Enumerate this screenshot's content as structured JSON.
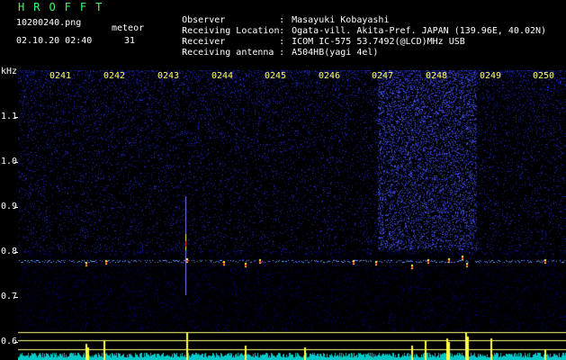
{
  "header": {
    "logo": "HROFFT",
    "logo_color": "#33ff66",
    "filename": "10200240.png",
    "datetime": "02.10.20 02:40",
    "meteor_label": "meteor",
    "meteor_count": "31"
  },
  "meta": [
    {
      "key": "Observer",
      "value": "Masayuki Kobayashi"
    },
    {
      "key": "Receiving Location",
      "value": "Ogata-vill. Akita-Pref. JAPAN (139.96E, 40.02N)"
    },
    {
      "key": "Receiver",
      "value": "ICOM IC-575 53.7492(@LCD)MHz USB"
    },
    {
      "key": "Receiving antenna",
      "value": "A504HB(yagi 4el)"
    }
  ],
  "axis": {
    "unit": "kHz",
    "freq_labels": [
      "1.1",
      "1.0",
      "0.9",
      "0.8",
      "0.7",
      "0.6"
    ],
    "time_labels": [
      "0241",
      "0242",
      "0243",
      "0244",
      "0245",
      "0246",
      "0247",
      "0248",
      "0249",
      "0250"
    ],
    "time_color": "#ffff66"
  },
  "colors": {
    "background": "#000000",
    "noise": "#1a1aa0",
    "trace": "#7faaff",
    "meteor_hot": "#ff3030",
    "meteor_warm": "#ffff40",
    "bottom_lines": "#ffff80",
    "bottom_bars": "#00ffff"
  }
}
